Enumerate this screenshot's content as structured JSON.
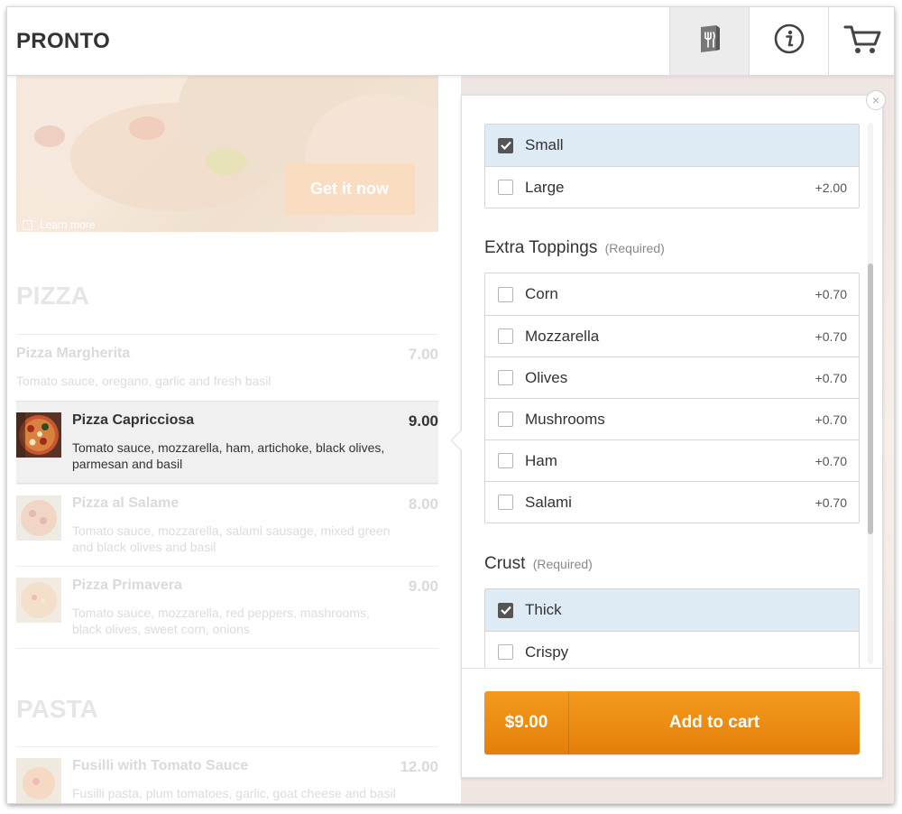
{
  "app": {
    "brand": "PRONTO"
  },
  "header": {
    "buttons": [
      {
        "name": "menu",
        "icon": "menu-icon"
      },
      {
        "name": "info",
        "icon": "info-icon"
      },
      {
        "name": "cart",
        "icon": "cart-icon"
      }
    ]
  },
  "hero": {
    "cta": "Get it now",
    "learn_more": "Learn more"
  },
  "menu": {
    "categories": [
      {
        "title": "PIZZA",
        "items": [
          {
            "name": "Pizza Margherita",
            "price": "7.00",
            "description": "Tomato sauce, oregano, garlic and fresh basil"
          },
          {
            "name": "Pizza Capricciosa",
            "price": "9.00",
            "description": "Tomato sauce, mozzarella, ham, artichoke, black olives, parmesan and basil",
            "selected": true
          },
          {
            "name": "Pizza al Salame",
            "price": "8.00",
            "description": "Tomato sauce, mozzarella, salami sausage, mixed green and black olives and basil"
          },
          {
            "name": "Pizza Primavera",
            "price": "9.00",
            "description": "Tomato sauce, mozzarella, red peppers, mashrooms, black olives, sweet corn, onions"
          }
        ]
      },
      {
        "title": "PASTA",
        "items": [
          {
            "name": "Fusilli with Tomato Sauce",
            "price": "12.00",
            "description": "Fusilli pasta, plum tomatoes, garlic, goat cheese and basil"
          }
        ]
      }
    ]
  },
  "options": {
    "size": [
      {
        "label": "Small",
        "price": "",
        "checked": true
      },
      {
        "label": "Large",
        "price": "+2.00",
        "checked": false
      }
    ],
    "toppings": {
      "title": "Extra Toppings",
      "required": "(Required)",
      "items": [
        {
          "label": "Corn",
          "price": "+0.70"
        },
        {
          "label": "Mozzarella",
          "price": "+0.70"
        },
        {
          "label": "Olives",
          "price": "+0.70"
        },
        {
          "label": "Mushrooms",
          "price": "+0.70"
        },
        {
          "label": "Ham",
          "price": "+0.70"
        },
        {
          "label": "Salami",
          "price": "+0.70"
        }
      ]
    },
    "crust": {
      "title": "Crust",
      "required": "(Required)",
      "items": [
        {
          "label": "Thick",
          "checked": true
        },
        {
          "label": "Crispy",
          "checked": false
        }
      ]
    }
  },
  "cart_button": {
    "price": "$9.00",
    "label": "Add to cart"
  },
  "colors": {
    "accent": "#ee8f14",
    "selected_row": "#deebf5"
  }
}
